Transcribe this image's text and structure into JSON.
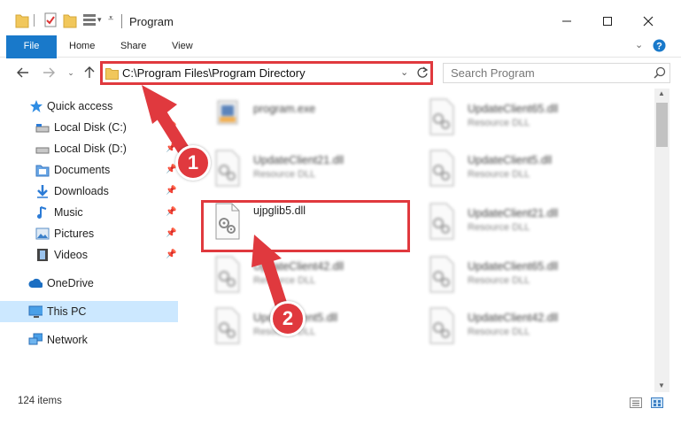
{
  "window": {
    "title": "Program"
  },
  "ribbon": {
    "tabs": [
      "File",
      "Home",
      "Share",
      "View"
    ]
  },
  "address": {
    "path": "C:\\Program Files\\Program Directory"
  },
  "search": {
    "placeholder": "Search Program"
  },
  "sidebar": {
    "items": [
      {
        "label": "Quick access",
        "icon": "star-icon"
      },
      {
        "label": "Local Disk (C:)",
        "icon": "drive-icon",
        "pinned": true
      },
      {
        "label": "Local Disk (D:)",
        "icon": "drive-icon",
        "pinned": true
      },
      {
        "label": "Documents",
        "icon": "documents-icon",
        "pinned": true
      },
      {
        "label": "Downloads",
        "icon": "downloads-icon",
        "pinned": true
      },
      {
        "label": "Music",
        "icon": "music-icon",
        "pinned": true
      },
      {
        "label": "Pictures",
        "icon": "pictures-icon",
        "pinned": true
      },
      {
        "label": "Videos",
        "icon": "videos-icon",
        "pinned": true
      },
      {
        "label": "OneDrive",
        "icon": "cloud-icon"
      },
      {
        "label": "This PC",
        "icon": "computer-icon",
        "selected": true
      },
      {
        "label": "Network",
        "icon": "network-icon"
      }
    ]
  },
  "files": [
    {
      "name": "program.exe",
      "type": ""
    },
    {
      "name": "UpdateClient65.dll",
      "type": "Resource DLL"
    },
    {
      "name": "UpdateClient21.dll",
      "type": "Resource DLL"
    },
    {
      "name": "UpdateClient5.dll",
      "type": "Resource DLL"
    },
    {
      "name": "ujpglib5.dll",
      "type": ""
    },
    {
      "name": "UpdateClient21.dll",
      "type": "Resource DLL"
    },
    {
      "name": "UpdateClient42.dll",
      "type": "Resource DLL"
    },
    {
      "name": "UpdateClient65.dll",
      "type": "Resource DLL"
    },
    {
      "name": "UpdateClient5.dll",
      "type": "Resource DLL"
    },
    {
      "name": "UpdateClient42.dll",
      "type": "Resource DLL"
    }
  ],
  "status": {
    "items_count": "124 items"
  },
  "annotations": {
    "step1": "1",
    "step2": "2"
  },
  "colors": {
    "accent": "#1979ca",
    "annotation": "#e0393e",
    "selection": "#cce8ff"
  }
}
